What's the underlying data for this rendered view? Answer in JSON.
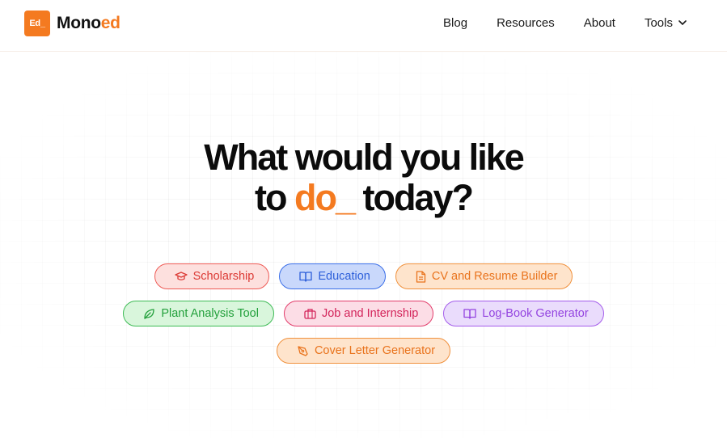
{
  "brand": {
    "badge": "Ed_",
    "name_main": "Mono",
    "name_accent": "ed"
  },
  "nav": {
    "blog": "Blog",
    "resources": "Resources",
    "about": "About",
    "tools": "Tools"
  },
  "hero": {
    "line1": "What would you like",
    "line2_pre": "to ",
    "line2_accent": "do_",
    "line2_post": " today?"
  },
  "chips": {
    "scholarship": "Scholarship",
    "education": "Education",
    "cv": "CV and Resume Builder",
    "plant": "Plant Analysis Tool",
    "job": "Job and Internship",
    "logbook": "Log-Book Generator",
    "cover": "Cover Letter Generator"
  },
  "colors": {
    "accent": "#f47a20"
  }
}
